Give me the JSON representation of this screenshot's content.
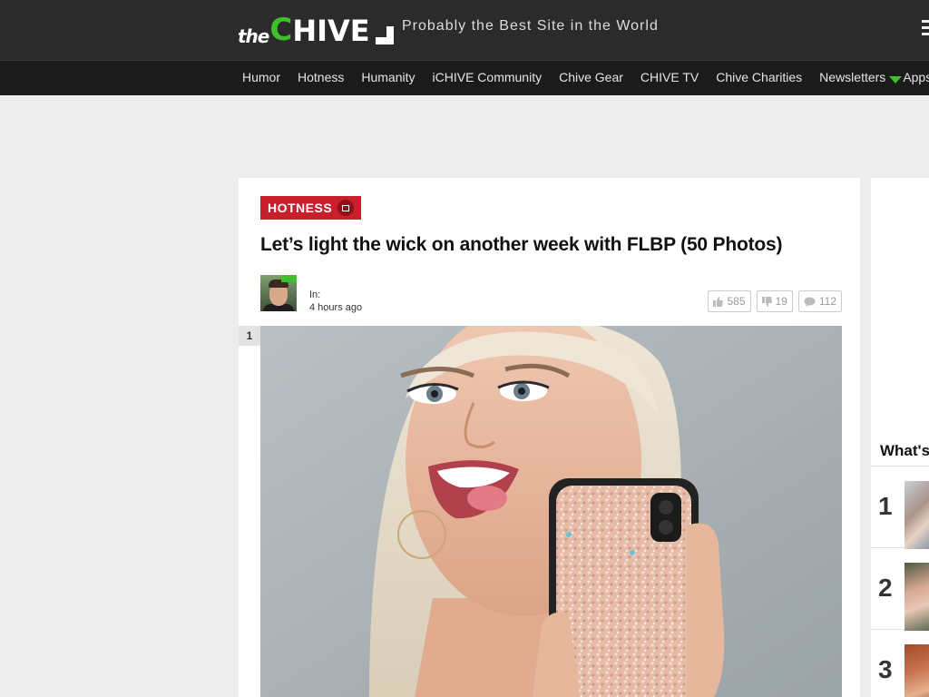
{
  "header": {
    "logo_the": "the",
    "logo_c": "C",
    "logo_hive": "HIVE",
    "tagline": "Probably the Best Site in the World"
  },
  "nav": {
    "items": [
      "Humor",
      "Hotness",
      "Humanity",
      "iCHIVE Community",
      "Chive Gear",
      "CHIVE TV",
      "Chive Charities",
      "Newsletters",
      "Apps"
    ]
  },
  "article": {
    "category": "HOTNESS",
    "title": "Let’s light the wick on another week with FLBP (50 Photos)",
    "meta_in": "In:",
    "meta_time": "4 hours ago",
    "likes": "585",
    "dislikes": "19",
    "comments": "112",
    "photo_number": "1"
  },
  "sidebar": {
    "title": "What's",
    "ranks": [
      "1",
      "2",
      "3"
    ]
  },
  "colors": {
    "accent_green": "#3fbf2b",
    "category_red": "#c8202a",
    "header_bg": "#2b2b2b",
    "nav_bg": "#1b1b1b"
  }
}
